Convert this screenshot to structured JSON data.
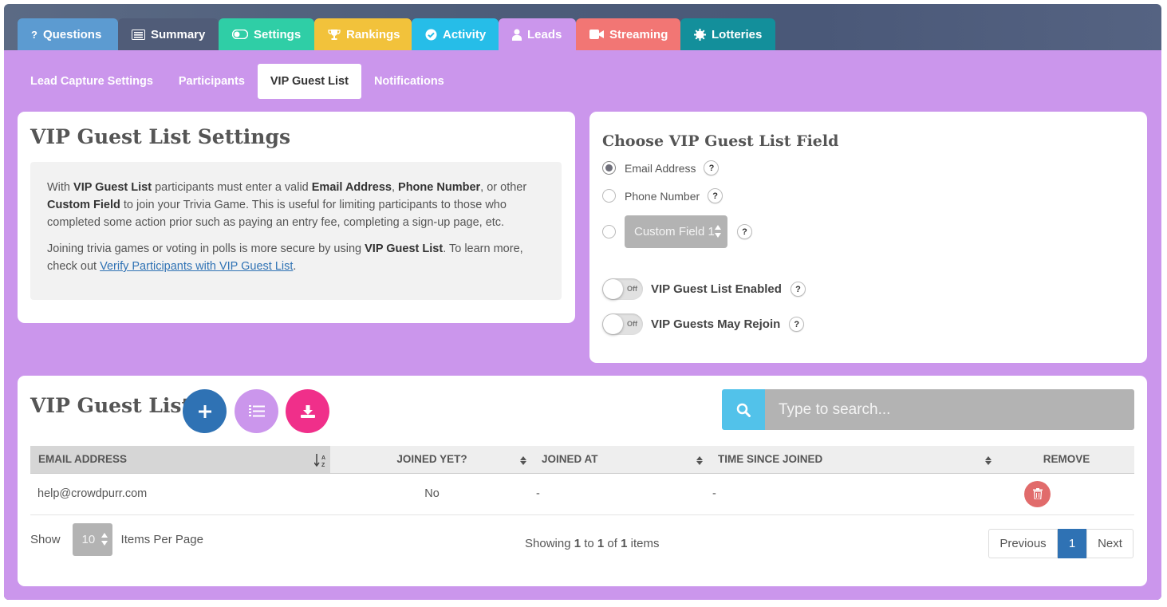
{
  "top_tabs": [
    {
      "label": "Questions",
      "icon": "question-icon",
      "color": "#5c9bd1"
    },
    {
      "label": "Summary",
      "icon": "list-icon",
      "color": "#505c78"
    },
    {
      "label": "Settings",
      "icon": "toggle-icon",
      "color": "#2fcea6"
    },
    {
      "label": "Rankings",
      "icon": "trophy-icon",
      "color": "#f2c23b"
    },
    {
      "label": "Activity",
      "icon": "check-circle-icon",
      "color": "#26bde8"
    },
    {
      "label": "Leads",
      "icon": "user-icon",
      "color": "#cb96ec"
    },
    {
      "label": "Streaming",
      "icon": "video-camera-icon",
      "color": "#f27674"
    },
    {
      "label": "Lotteries",
      "icon": "gear-icon",
      "color": "#138f9b"
    }
  ],
  "sub_tabs": [
    {
      "label": "Lead Capture Settings"
    },
    {
      "label": "Participants"
    },
    {
      "label": "VIP Guest List"
    },
    {
      "label": "Notifications"
    }
  ],
  "settings_panel": {
    "title": "VIP Guest List Settings",
    "p1": {
      "t1": "With ",
      "b1": "VIP Guest List",
      "t2": " participants must enter a valid ",
      "b2": "Email Address",
      "t3": ", ",
      "b3": "Phone Number",
      "t4": ", or other ",
      "b4": "Custom Field",
      "t5": " to join your Trivia Game. This is useful for limiting participants to those who completed some action prior such as paying an entry fee, completing a sign-up page, etc."
    },
    "p2": {
      "t1": "Joining trivia games or voting in polls is more secure by using ",
      "b1": "VIP Guest List",
      "t2": ". To learn more, check out ",
      "link": "Verify Participants with VIP Guest List",
      "t3": "."
    }
  },
  "field_panel": {
    "title": "Choose VIP Guest List Field",
    "options": {
      "email": "Email Address",
      "phone": "Phone Number",
      "custom": "Custom Field 1"
    },
    "help": "?",
    "toggle_enabled_label": "VIP Guest List Enabled",
    "toggle_rejoin_label": "VIP Guests May Rejoin",
    "toggle_state": "Off"
  },
  "list_panel": {
    "title": "VIP Guest List",
    "search_placeholder": "Type to search...",
    "columns": [
      "EMAIL ADDRESS",
      "JOINED YET?",
      "JOINED AT",
      "TIME SINCE JOINED",
      "REMOVE"
    ],
    "rows": [
      {
        "email": "help@crowdpurr.com",
        "joined": "No",
        "joined_at": "-",
        "since": "-"
      }
    ],
    "show_label": "Show",
    "per_page": "10",
    "items_per_page_label": "Items Per Page",
    "showing": {
      "t1": "Showing ",
      "from": "1",
      "t2": " to ",
      "to": "1",
      "t3": " of ",
      "total": "1",
      "t4": " items"
    },
    "pager": {
      "prev": "Previous",
      "current": "1",
      "next": "Next"
    }
  },
  "colors": {
    "purple": "#cb96ec",
    "blue_button": "#2f72b4",
    "lavender_button": "#cb96ec",
    "pink_button": "#f02f8a",
    "search_button": "#52c2ea",
    "trash": "#e16b6b"
  }
}
